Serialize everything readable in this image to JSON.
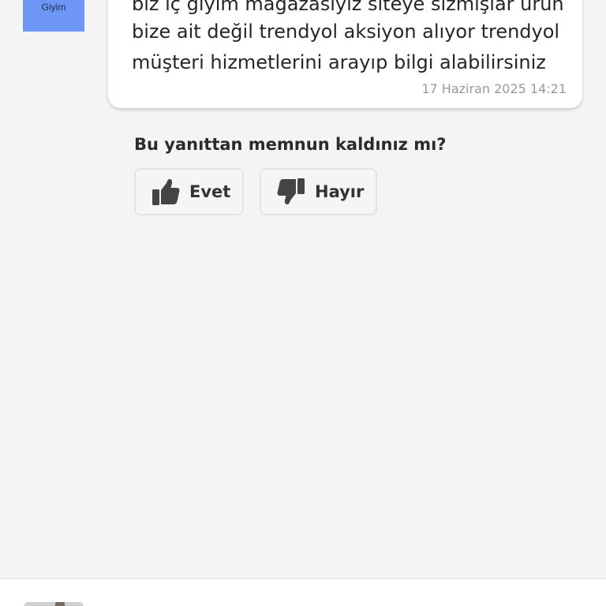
{
  "store_avatar": {
    "label": "Giyim",
    "color": "#6d96f7"
  },
  "message": {
    "lines": [
      "biz iç giyim mağazasıyız siteye sızmışlar ürün",
      "bize ait değil trendyol aksiyon alıyor trendyol",
      "müşteri hizmetlerini arayıp bilgi alabilirsiniz"
    ],
    "timestamp": "17 Haziran 2025 14:21"
  },
  "feedback": {
    "question": "Bu yanıttan memnun kaldınız mı?",
    "yes_label": "Evet",
    "yes_icon": "thumbs-up-icon",
    "no_label": "Hayır",
    "no_icon": "thumbs-down-icon"
  }
}
